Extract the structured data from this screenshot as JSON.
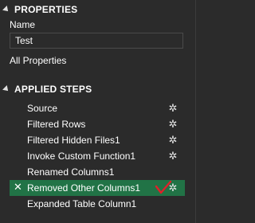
{
  "properties": {
    "header": "PROPERTIES",
    "name_label": "Name",
    "name_value": "Test",
    "all_properties_link": "All Properties"
  },
  "applied_steps": {
    "header": "APPLIED STEPS",
    "items": [
      {
        "label": "Source",
        "has_gear": true,
        "selected": false
      },
      {
        "label": "Filtered Rows",
        "has_gear": true,
        "selected": false
      },
      {
        "label": "Filtered Hidden Files1",
        "has_gear": true,
        "selected": false
      },
      {
        "label": "Invoke Custom Function1",
        "has_gear": true,
        "selected": false
      },
      {
        "label": "Renamed Columns1",
        "has_gear": false,
        "selected": false
      },
      {
        "label": "Removed Other Columns1",
        "has_gear": true,
        "selected": true
      },
      {
        "label": "Expanded Table Column1",
        "has_gear": false,
        "selected": false
      }
    ]
  },
  "colors": {
    "background": "#2b2b2b",
    "selected_row": "#217346",
    "check_mark": "#e0202a"
  }
}
